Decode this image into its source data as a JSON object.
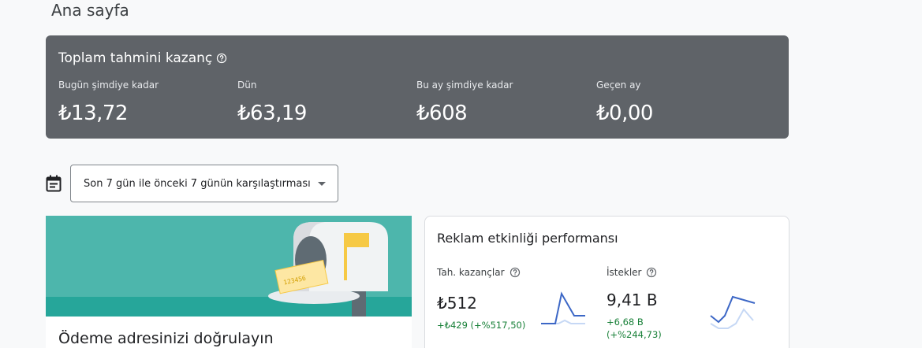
{
  "page": {
    "title": "Ana sayfa"
  },
  "earnings": {
    "title": "Toplam tahmini kazanç",
    "metrics": [
      {
        "label": "Bugün şimdiye kadar",
        "value": "₺13,72"
      },
      {
        "label": "Dün",
        "value": "₺63,19"
      },
      {
        "label": "Bu ay şimdiye kadar",
        "value": "₺608"
      },
      {
        "label": "Geçen ay",
        "value": "₺0,00"
      }
    ]
  },
  "date_range": {
    "selected": "Son 7 gün ile önceki 7 günün karşılaştırması"
  },
  "address_card": {
    "title": "Ödeme adresinizi doğrulayın",
    "mail_code": "123456"
  },
  "performance": {
    "title": "Reklam etkinliği performansı",
    "stats": [
      {
        "label": "Tah. kazançlar",
        "value": "₺512",
        "delta": "+₺429 (+%517,50)"
      },
      {
        "label": "İstekler",
        "value": "9,41 B",
        "delta_line1": "+6,68 B",
        "delta_line2": "(+%244,73)"
      }
    ]
  },
  "colors": {
    "earnings_bg": "#5f6368",
    "banner": "#4db6ac",
    "positive": "#188038",
    "spark_current": "#3c67c6",
    "spark_previous": "#c6d8f5"
  },
  "icons": [
    "help-icon",
    "calendar-icon",
    "dropdown-arrow-icon",
    "mailbox-illustration"
  ]
}
